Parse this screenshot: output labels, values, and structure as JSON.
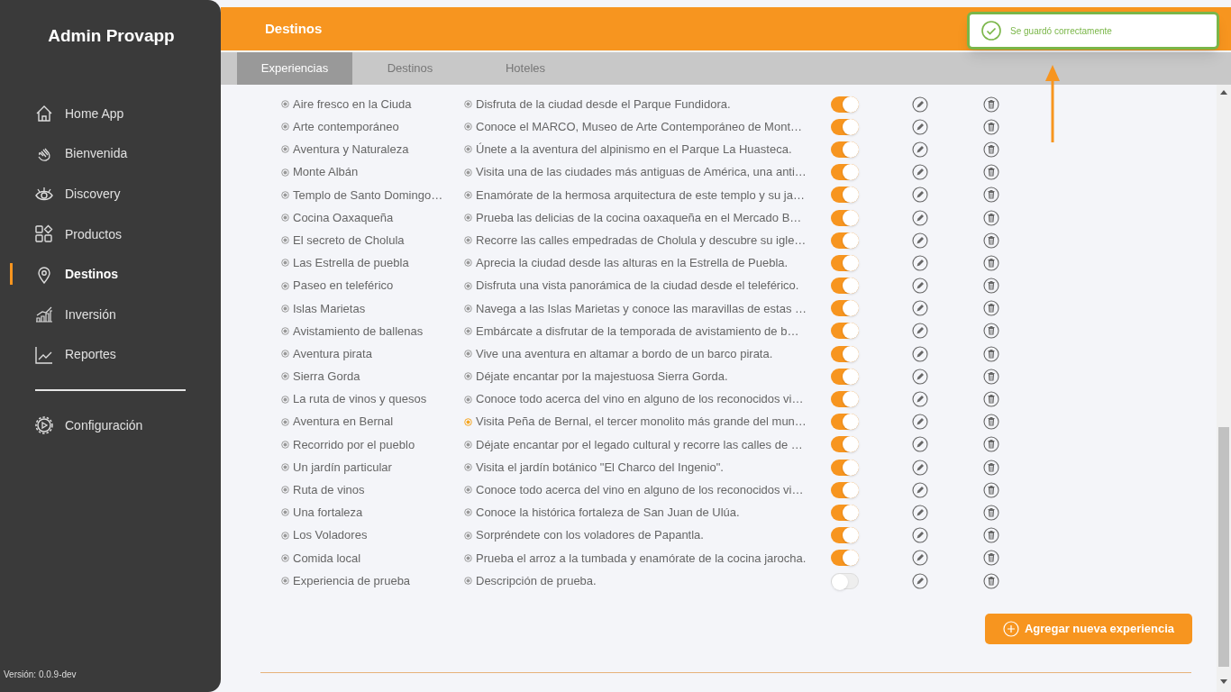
{
  "sidebar": {
    "title": "Admin Provapp",
    "items": [
      {
        "label": "Home App",
        "kind": "home",
        "selected": false
      },
      {
        "label": "Bienvenida",
        "kind": "hand",
        "selected": false
      },
      {
        "label": "Discovery",
        "kind": "eye",
        "selected": false
      },
      {
        "label": "Productos",
        "kind": "grid",
        "selected": false
      },
      {
        "label": "Destinos",
        "kind": "pin",
        "selected": true
      },
      {
        "label": "Inversión",
        "kind": "bars",
        "selected": false
      },
      {
        "label": "Reportes",
        "kind": "chart",
        "selected": false
      }
    ],
    "footer_items": [
      {
        "label": "Configuración",
        "kind": "gear",
        "selected": false
      }
    ],
    "version": "Versión: 0.0.9-dev"
  },
  "header": {
    "title": "Destinos"
  },
  "toast": {
    "message": "Se guardó correctamente"
  },
  "tabs": [
    {
      "label": "Experiencias",
      "selected": true
    },
    {
      "label": "Destinos",
      "selected": false
    },
    {
      "label": "Hoteles",
      "selected": false
    }
  ],
  "rows": [
    {
      "name": "Aire fresco en la Ciuda",
      "description": "Disfruta de la ciudad desde el Parque Fundidora.",
      "on": true,
      "selected": false
    },
    {
      "name": "Arte contemporáneo",
      "description": "Conoce el MARCO, Museo de Arte Contemporáneo de Mont…",
      "on": true,
      "selected": false
    },
    {
      "name": "Aventura y Naturaleza",
      "description": "Únete a la aventura del alpinismo en el Parque La Huasteca.",
      "on": true,
      "selected": false
    },
    {
      "name": "Monte Albán",
      "description": "Visita una de las ciudades más antiguas de América, una anti…",
      "on": true,
      "selected": false
    },
    {
      "name": "Templo de Santo Domingo…",
      "description": "Enamórate de la hermosa arquitectura de este templo y su ja…",
      "on": true,
      "selected": false
    },
    {
      "name": "Cocina Oaxaqueña",
      "description": "Prueba las delicias de la cocina oaxaqueña en el Mercado B…",
      "on": true,
      "selected": false
    },
    {
      "name": "El secreto de Cholula",
      "description": "Recorre las calles empedradas de Cholula y descubre su igle…",
      "on": true,
      "selected": false
    },
    {
      "name": "Las Estrella de puebla",
      "description": "Aprecia la ciudad desde las alturas en la Estrella de Puebla.",
      "on": true,
      "selected": false
    },
    {
      "name": "Paseo en teleférico",
      "description": "Disfruta una vista panorámica de la ciudad desde el teleférico.",
      "on": true,
      "selected": false
    },
    {
      "name": "Islas Marietas",
      "description": "Navega a las Islas Marietas y conoce las maravillas de estas …",
      "on": true,
      "selected": false
    },
    {
      "name": "Avistamiento de ballenas",
      "description": "Embárcate a disfrutar de la temporada de avistamiento de b…",
      "on": true,
      "selected": false
    },
    {
      "name": "Aventura pirata",
      "description": "Vive una aventura en altamar a bordo de un barco pirata.",
      "on": true,
      "selected": false
    },
    {
      "name": "Sierra Gorda",
      "description": "Déjate encantar por la majestuosa Sierra Gorda.",
      "on": true,
      "selected": false
    },
    {
      "name": "La ruta de vinos y quesos",
      "description": "Conoce todo acerca del vino en alguno de los reconocidos vi…",
      "on": true,
      "selected": false
    },
    {
      "name": "Aventura en Bernal",
      "description": "Visita Peña de Bernal, el tercer monolito más grande del mun…",
      "on": true,
      "selected": true
    },
    {
      "name": "Recorrido por el pueblo",
      "description": "Déjate encantar por el legado cultural y recorre las calles de …",
      "on": true,
      "selected": false
    },
    {
      "name": "Un jardín particular",
      "description": "Visita el jardín botánico \"El Charco del Ingenio\".",
      "on": true,
      "selected": false
    },
    {
      "name": "Ruta de vinos",
      "description": "Conoce todo acerca del vino en alguno de los reconocidos vi…",
      "on": true,
      "selected": false
    },
    {
      "name": "Una fortaleza",
      "description": "Conoce la histórica fortaleza de San Juan de Ulúa.",
      "on": true,
      "selected": false
    },
    {
      "name": "Los Voladores",
      "description": "Sorpréndete con los voladores de Papantla.",
      "on": true,
      "selected": false
    },
    {
      "name": "Comida local",
      "description": "Prueba el arroz a la tumbada y enamórate de la cocina jarocha.",
      "on": true,
      "selected": false
    },
    {
      "name": "Experiencia de prueba",
      "description": "Descripción de prueba.",
      "on": false,
      "selected": false
    }
  ],
  "add_button": {
    "label": "Agregar nueva experiencia"
  }
}
